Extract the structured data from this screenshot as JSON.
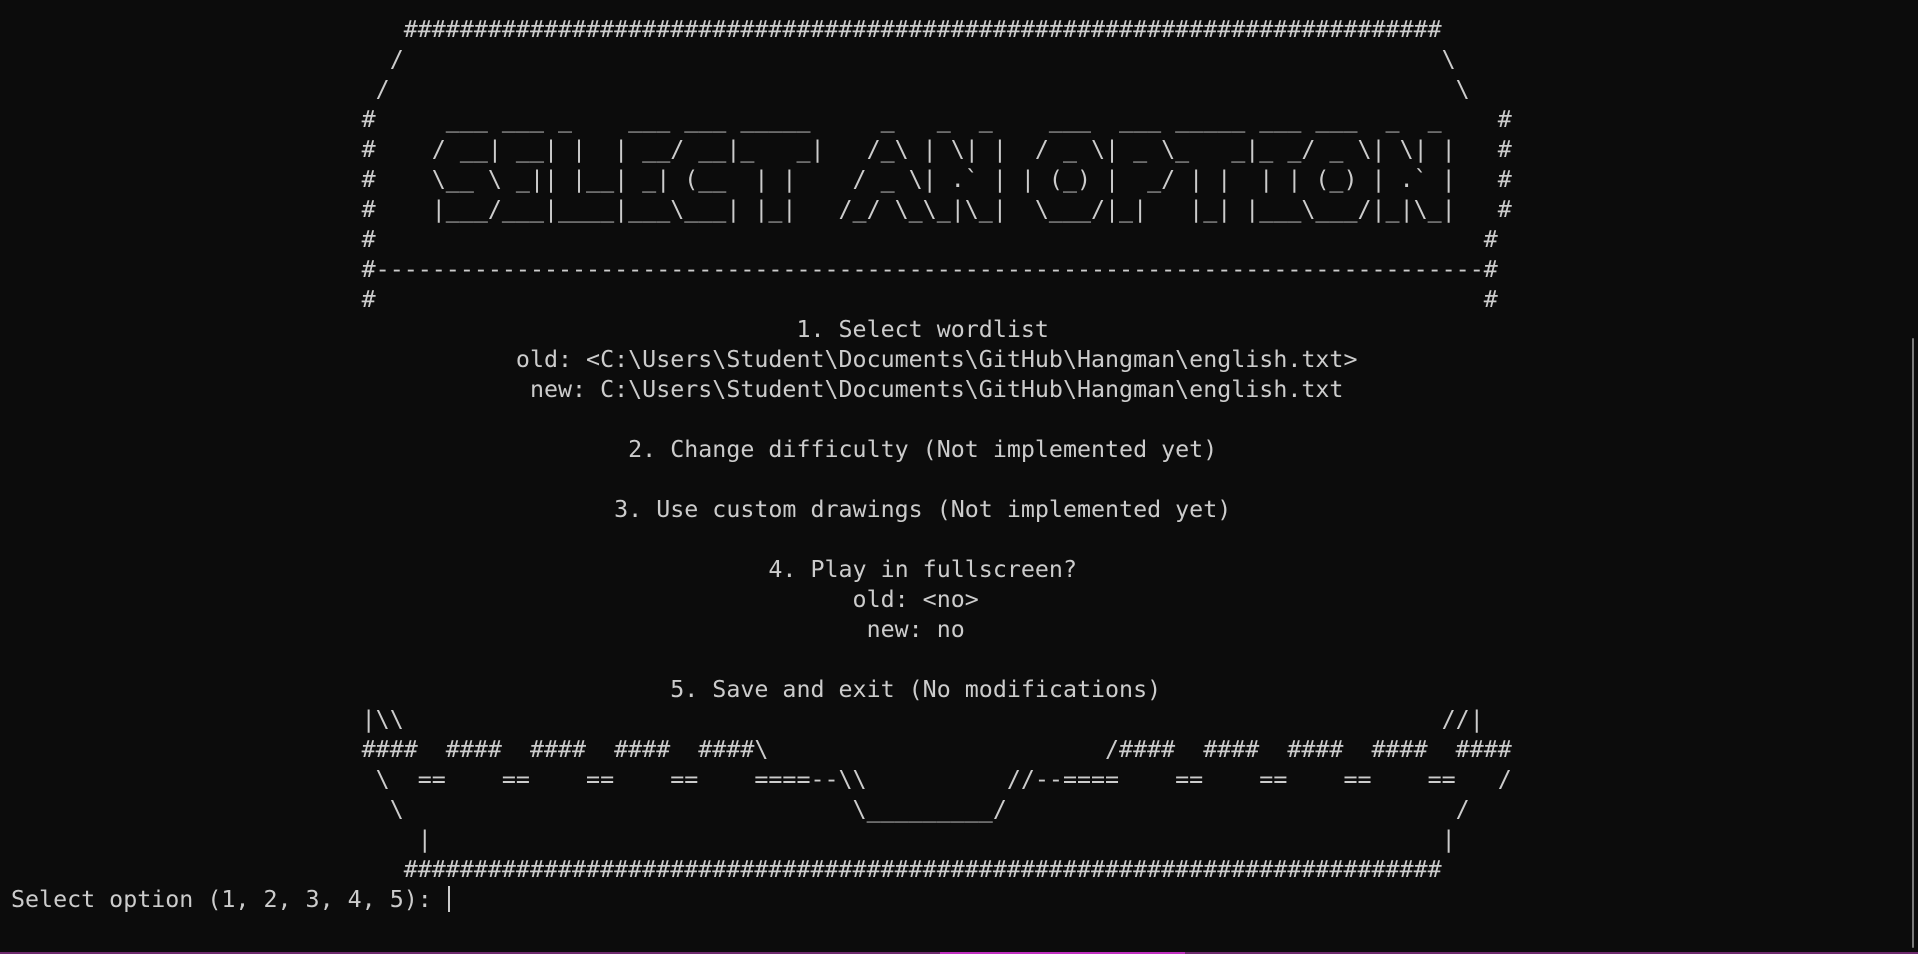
{
  "terminal": {
    "lines": [
      "                            ##########################################################################",
      "                           /                                                                          \\",
      "                          /                                                                            \\",
      "                         #     ___ ___ _    ___ ___ _____     _   _  _    ___  ___ _____ ___ ___  _  _    #",
      "                         #    / __| __| |  | __/ __|_   _|   /_\\ | \\| |  / _ \\| _ \\_   _|_ _/ _ \\| \\| |   #",
      "                         #    \\__ \\ _|| |__| _| (__  | |    / _ \\| .` | | (_) |  _/ | |  | | (_) | .` |   #",
      "                         #    |___/___|____|___\\___| |_|   /_/ \\_\\_|\\_|  \\___/|_|   |_| |___\\___/|_|\\_|   #",
      "                         #                                                                               #",
      "                         #-------------------------------------------------------------------------------#",
      "                         #                                                                               #",
      "                                                        1. Select wordlist",
      "                                    old: <C:\\Users\\Student\\Documents\\GitHub\\Hangman\\english.txt>",
      "                                     new: C:\\Users\\Student\\Documents\\GitHub\\Hangman\\english.txt",
      "",
      "                                            2. Change difficulty (Not implemented yet)",
      "",
      "                                           3. Use custom drawings (Not implemented yet)",
      "",
      "                                                      4. Play in fullscreen?",
      "                                                            old: <no>",
      "                                                             new: no",
      "",
      "                                               5. Save and exit (No modifications)",
      "                         |\\\\                                                                          //|",
      "                         ####  ####  ####  ####  ####\\                        /####  ####  ####  ####  ####",
      "                          \\  ==    ==    ==    ==    ====--\\\\          //--====    ==    ==    ==    ==   /",
      "                           \\                                \\_________/                                /",
      "                             |                                                                        |",
      "                            ##########################################################################"
    ],
    "prompt": "Select option (1, 2, 3, 4, 5): "
  },
  "colors": {
    "background": "#0c0c0c",
    "foreground": "#cccccc",
    "accent": "#c030c0"
  }
}
